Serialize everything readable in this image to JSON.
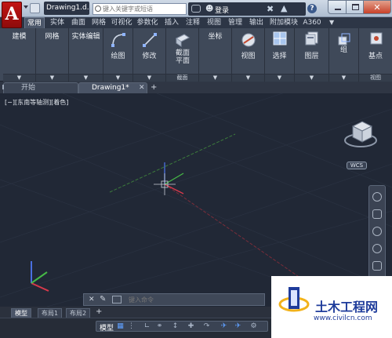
{
  "window": {
    "doc_title": "Drawing1.d...",
    "search_placeholder": "键入关键字或短语",
    "login": "登录",
    "help": "?",
    "close": "✕"
  },
  "ribbon_tabs": [
    "常用",
    "实体",
    "曲面",
    "网格",
    "可视化",
    "参数化",
    "插入",
    "注释",
    "视图",
    "管理",
    "输出",
    "附加模块",
    "A360"
  ],
  "panels": [
    {
      "label": "建模"
    },
    {
      "label": "网格"
    },
    {
      "label": "实体编辑"
    },
    {
      "label": "绘图"
    },
    {
      "label": "修改"
    },
    {
      "label": "截面平面",
      "foot": "截面"
    },
    {
      "label": "坐标"
    },
    {
      "label": "视图"
    },
    {
      "label": "选择"
    },
    {
      "label": "图层"
    },
    {
      "label": "组"
    },
    {
      "label": "基点",
      "foot": "视图"
    }
  ],
  "file_tabs": {
    "start": "开始",
    "drawing": "Drawing1*",
    "add": "+"
  },
  "viewport": {
    "label": "[−][东南等轴测][着色]",
    "wcs": "WCS"
  },
  "command": {
    "placeholder": "键入命令"
  },
  "layout_tabs": [
    "模型",
    "布局1",
    "布局2"
  ],
  "layout_add": "+",
  "status": {
    "model": "模型"
  },
  "watermark": {
    "title": "土木工程网",
    "url": "www.civilcn.com"
  },
  "colors": {
    "accent": "#c21414",
    "viewport_bg": "#212836",
    "ribbon_bg": "#3f4959",
    "axis_x": "#d8394b",
    "axis_y": "#46b946",
    "axis_z": "#4a6fe0",
    "watermark_blue": "#1f3c9b"
  }
}
